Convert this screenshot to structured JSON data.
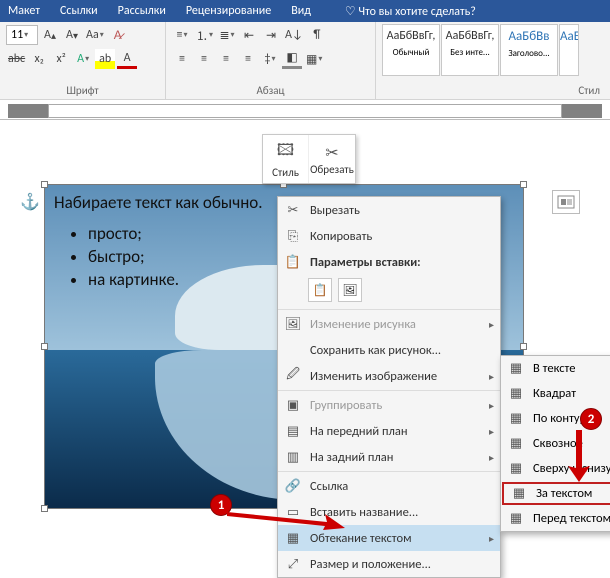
{
  "tabs": [
    "Макет",
    "Ссылки",
    "Рассылки",
    "Рецензирование",
    "Вид"
  ],
  "tellme": "Что вы хотите сделать?",
  "font": {
    "size": "11",
    "group": "Шрифт"
  },
  "para": {
    "group": "Абзац"
  },
  "styles": {
    "group": "Стил",
    "sample": "АаБбВвГг,",
    "sampleShort": "АаБбВв",
    "items": [
      "Обычный",
      "Без инте...",
      "Заголово..."
    ]
  },
  "document": {
    "line": "Набираете текст как обычно.",
    "bullets": [
      "просто;",
      "быстро;",
      "на картинке."
    ]
  },
  "mini": {
    "style": "Стиль",
    "crop": "Обрезать"
  },
  "ctx": {
    "cut": "Вырезать",
    "copy": "Копировать",
    "pasteHead": "Параметры вставки:",
    "changePic": "Изменение рисунка",
    "saveAs": "Сохранить как рисунок...",
    "editImg": "Изменить изображение",
    "group": "Группировать",
    "front": "На передний план",
    "back": "На задний план",
    "link": "Ссылка",
    "caption": "Вставить название...",
    "wrap": "Обтекание текстом",
    "sizePos": "Размер и положение..."
  },
  "wrap": {
    "inText": "В тексте",
    "square": "Квадрат",
    "tight": "По контуру",
    "through": "Сквозное",
    "topBottom": "Сверху и снизу",
    "behind": "За текстом",
    "front": "Перед текстом"
  },
  "badges": {
    "b1": "1",
    "b2": "2"
  }
}
